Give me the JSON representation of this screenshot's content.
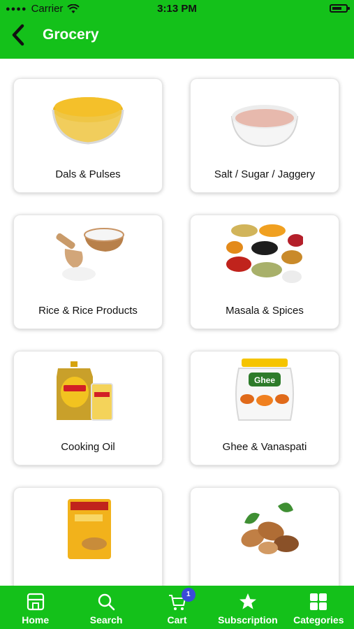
{
  "status_bar": {
    "carrier": "Carrier",
    "time": "3:13 PM"
  },
  "header": {
    "title": "Grocery"
  },
  "categories": [
    {
      "label": "Dals & Pulses",
      "icon": "lentils-bowl"
    },
    {
      "label": "Salt / Sugar / Jaggery",
      "icon": "salt-bowl"
    },
    {
      "label": "Rice & Rice Products",
      "icon": "rice-scoop"
    },
    {
      "label": "Masala & Spices",
      "icon": "spice-bowls"
    },
    {
      "label": "Cooking Oil",
      "icon": "oil-can"
    },
    {
      "label": "Ghee & Vanaspati",
      "icon": "ghee-jar"
    },
    {
      "label": "",
      "icon": "atta-pack"
    },
    {
      "label": "",
      "icon": "almonds"
    }
  ],
  "bottom_nav": {
    "items": [
      {
        "label": "Home",
        "icon": "store-icon"
      },
      {
        "label": "Search",
        "icon": "search-icon"
      },
      {
        "label": "Cart",
        "icon": "cart-icon",
        "badge": "1"
      },
      {
        "label": "Subscription",
        "icon": "star-icon"
      },
      {
        "label": "Categories",
        "icon": "grid-icon"
      }
    ]
  },
  "colors": {
    "primary": "#14c11a",
    "badge": "#3a4bd8"
  }
}
